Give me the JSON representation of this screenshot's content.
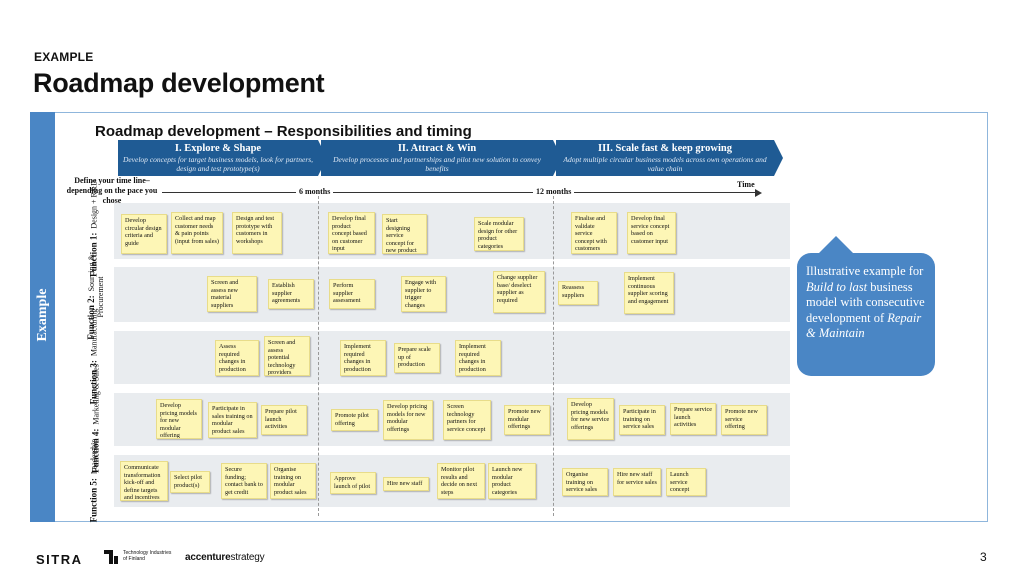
{
  "header": {
    "eyebrow": "EXAMPLE",
    "title": "Roadmap development"
  },
  "sidebar_label": "Example",
  "subtitle": "Roadmap development – Responsibilities and timing",
  "phases": [
    {
      "title": "I. Explore & Shape",
      "desc": "Develop concepts for target business models, look for partners, design and test prototype(s)"
    },
    {
      "title": "II. Attract & Win",
      "desc": "Develop processes and partnerships and pilot new solution to convey benefits"
    },
    {
      "title": "III. Scale fast & keep growing",
      "desc": "Adopt multiple circular business models across own operations and value chain"
    }
  ],
  "timeline": {
    "define": "Define your time line– depending on the pace you chose",
    "six": "6 months",
    "twelve": "12 months",
    "time": "Time"
  },
  "functions": [
    {
      "num": "Function 1:",
      "name": "Design + R&D",
      "notes": [
        "Develop circular design criteria and guide",
        "Collect and map customer needs & pain points (input from sales)",
        "Design and test prototype with customers in workshops",
        "Develop final product concept based on customer input",
        "Start designing service concept for new product",
        "Scale modular design for other product categories",
        "Finalise and validate service concept with customers",
        "Develop final service concept based on customer input"
      ]
    },
    {
      "num": "Function 2:",
      "name": "Sourcing & Procurement",
      "notes": [
        "Screen and assess new material suppliers",
        "Establish supplier agreements",
        "Perform supplier assessment",
        "Engage with supplier to trigger changes",
        "Change supplier base/ deselect supplier as required",
        "Reassess suppliers",
        "Implement continuous supplier scoring and engagement"
      ]
    },
    {
      "num": "Function 3:",
      "name": "Manufacturing",
      "notes": [
        "Assess required changes in production",
        "Screen and assess potential technology providers",
        "Implement required changes in production",
        "Prepare scale up of production",
        "Implement required changes in production"
      ]
    },
    {
      "num": "Function 4:",
      "name": "Marketing & Sales",
      "notes": [
        "Develop pricing models for new modular offering",
        "Participate in sales training on modular product sales",
        "Prepare pilot launch activities",
        "Promote pilot offering",
        "Develop pricing models for new modular offerings",
        "Screen technology partners for service concept",
        "Promote new modular offerings",
        "Develop pricing models for new service offerings",
        "Participate in training on service sales",
        "Prepare service launch activities",
        "Promote new service offering"
      ]
    },
    {
      "num": "Function 5:",
      "name": "Leadership",
      "notes": [
        "Communicate transformation kick-off and define targets and incentives",
        "Select pilot product(s)",
        "Secure funding; contact bank to get credit",
        "Organise training on modular product sales",
        "Approve launch of pilot",
        "Hire new staff",
        "Monitor pilot results and decide on next steps",
        "Launch new modular product categories",
        "Organise training on service sales",
        "Hire new staff for service sales",
        "Launch service concept"
      ]
    }
  ],
  "callout": {
    "pre": "Illustrative example for ",
    "em1": "Build to last",
    "mid": " business model with consecutive development of ",
    "em2": "Repair & Maintain"
  },
  "footer": {
    "page": "3",
    "sitra": "SITRA",
    "ti1": "Technology Industries",
    "ti2": "of Finland",
    "acc1": "accenture",
    "acc2": "strategy"
  },
  "colors": {
    "brand_blue": "#1f5b94",
    "sidebar_blue": "#4a86c5",
    "sticky": "#fdf6b6"
  }
}
